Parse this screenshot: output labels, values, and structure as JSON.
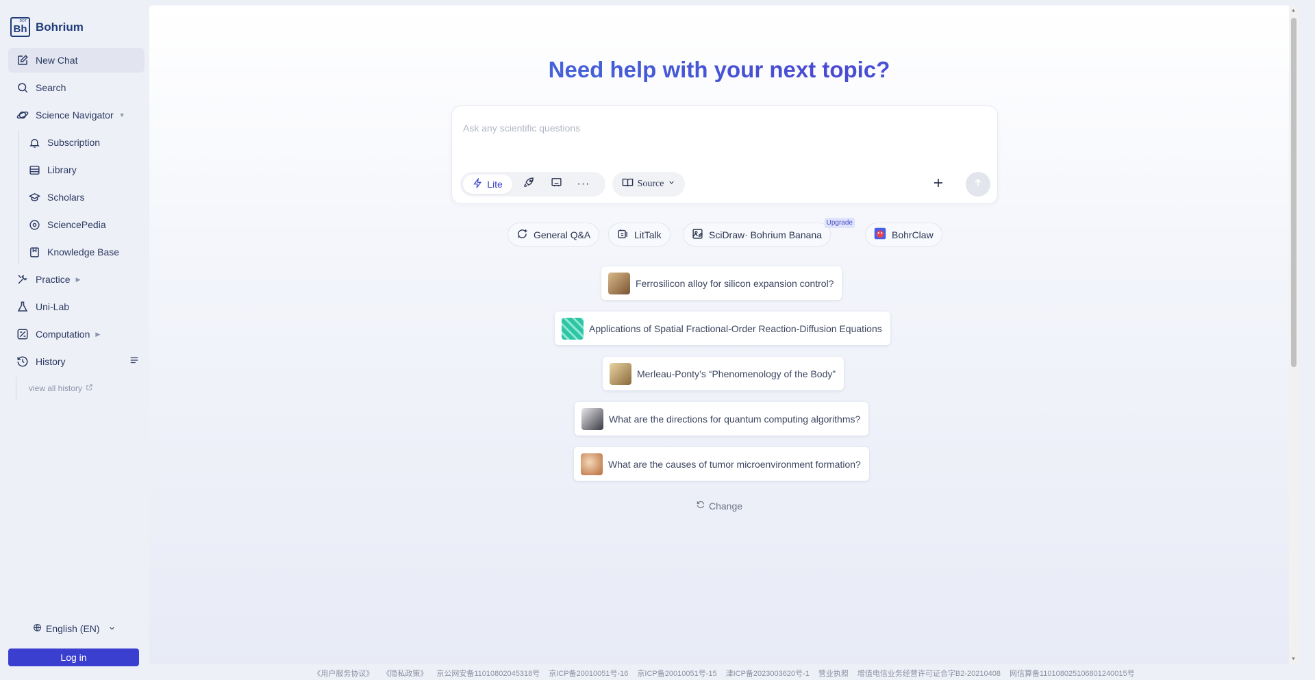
{
  "brand": {
    "name": "Bohrium",
    "mark": "Bh",
    "mark_small": "DOT"
  },
  "sidebar": {
    "new_chat": "New Chat",
    "search": "Search",
    "science_navigator": "Science Navigator",
    "sub_items": [
      "Subscription",
      "Library",
      "Scholars",
      "SciencePedia",
      "Knowledge Base"
    ],
    "practice": "Practice",
    "unilab": "Uni-Lab",
    "computation": "Computation",
    "history": "History",
    "view_all_history": "view all history",
    "language": "English (EN)",
    "login": "Log in"
  },
  "main": {
    "headline": "Need help with your next topic?",
    "composer": {
      "placeholder": "Ask any scientific questions",
      "mode_label": "Lite",
      "source_label": "Source"
    },
    "chips": [
      {
        "label": "General Q&A",
        "icon": "chat-plus-icon"
      },
      {
        "label": "LitTalk",
        "icon": "book-open-icon"
      },
      {
        "label": "SciDraw· Bohrium Banana",
        "icon": "image-edit-icon",
        "badge": "Upgrade"
      },
      {
        "label": "BohrClaw",
        "icon": "bohrclaw-logo-icon"
      }
    ],
    "suggestions": [
      {
        "text": "Ferrosilicon alloy for silicon expansion control?",
        "thumb_color": "#a07850"
      },
      {
        "text": "Applications of Spatial Fractional-Order Reaction-Diffusion Equations",
        "thumb_color": "#2ec4a6"
      },
      {
        "text": "Merleau-Ponty’s “Phenomenology of the Body”",
        "thumb_color": "#c4a468"
      },
      {
        "text": "What are the directions for quantum computing algorithms?",
        "thumb_color": "#5a5a66"
      },
      {
        "text": "What are the causes of tumor microenvironment formation?",
        "thumb_color": "#d9a37a"
      }
    ],
    "change_label": "Change"
  },
  "footer": [
    "《用户服务协议》",
    "《隐私政策》",
    "京公网安备11010802045318号",
    "京ICP备20010051号-16",
    "京ICP备20010051号-15",
    "津ICP备2023003620号-1",
    "营业执照",
    "增值电信业务经营许可证合字B2-20210408",
    "网信算备110108025106801240015号"
  ],
  "colors": {
    "accent": "#3b3fd0",
    "headline_start": "#3a86e6",
    "headline_mid": "#4a4ad1"
  }
}
